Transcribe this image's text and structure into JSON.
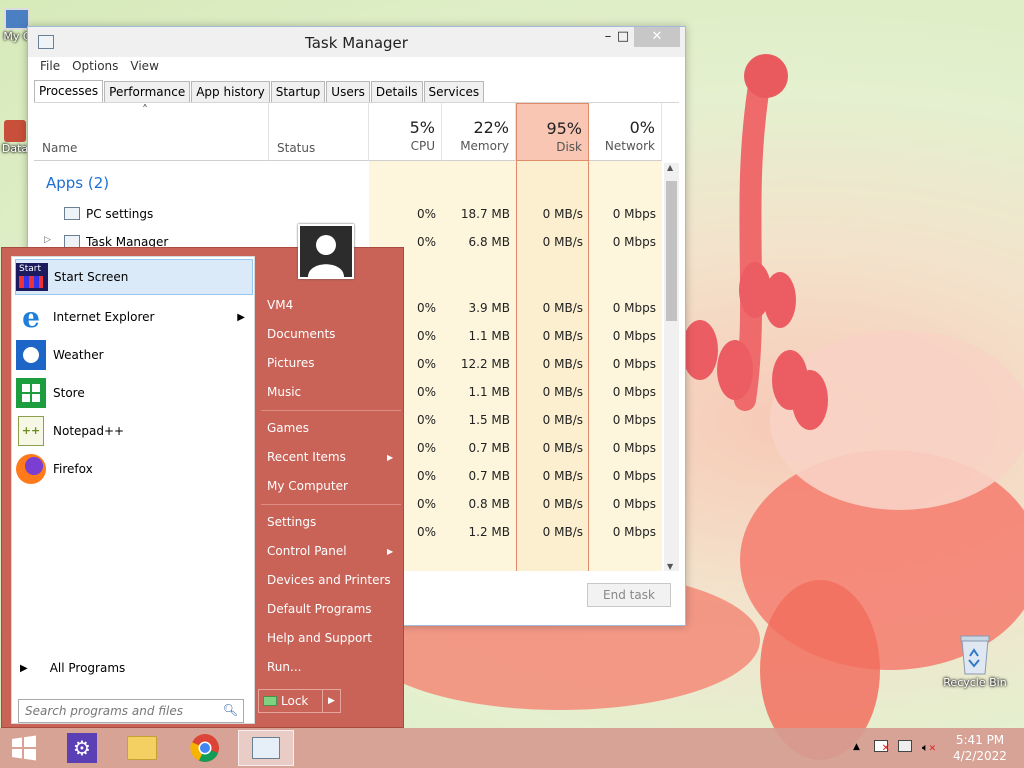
{
  "desktop": {
    "icons": [
      {
        "label": "My C",
        "icon": "computer-icon"
      },
      {
        "label": "Data",
        "icon": "database-icon"
      },
      {
        "label": "Recycle Bin",
        "icon": "recycle-bin-icon"
      }
    ]
  },
  "task_manager": {
    "title": "Task Manager",
    "window_buttons": {
      "minimize": "–",
      "maximize": "□",
      "close": "✕"
    },
    "menu": [
      "File",
      "Options",
      "View"
    ],
    "tabs": [
      "Processes",
      "Performance",
      "App history",
      "Startup",
      "Users",
      "Details",
      "Services"
    ],
    "active_tab": "Processes",
    "sort_indicator": "˄",
    "columns": {
      "name": "Name",
      "status": "Status",
      "cpu": {
        "pct": "5%",
        "label": "CPU"
      },
      "memory": {
        "pct": "22%",
        "label": "Memory"
      },
      "disk": {
        "pct": "95%",
        "label": "Disk"
      },
      "network": {
        "pct": "0%",
        "label": "Network"
      }
    },
    "group_apps": "Apps (2)",
    "apps": [
      {
        "name": "PC settings",
        "cpu": "0%",
        "memory": "18.7 MB",
        "disk": "0 MB/s",
        "network": "0 Mbps"
      },
      {
        "name": "Task Manager",
        "cpu": "0%",
        "memory": "6.8 MB",
        "disk": "0 MB/s",
        "network": "0 Mbps"
      }
    ],
    "background_rows": [
      {
        "cpu": "0%",
        "memory": "3.9 MB",
        "disk": "0 MB/s",
        "network": "0 Mbps"
      },
      {
        "cpu": "0%",
        "memory": "1.1 MB",
        "disk": "0 MB/s",
        "network": "0 Mbps"
      },
      {
        "cpu": "0%",
        "memory": "12.2 MB",
        "disk": "0 MB/s",
        "network": "0 Mbps"
      },
      {
        "cpu": "0%",
        "memory": "1.1 MB",
        "disk": "0 MB/s",
        "network": "0 Mbps"
      },
      {
        "cpu": "0%",
        "memory": "1.5 MB",
        "disk": "0 MB/s",
        "network": "0 Mbps"
      },
      {
        "cpu": "0%",
        "memory": "0.7 MB",
        "disk": "0 MB/s",
        "network": "0 Mbps"
      },
      {
        "cpu": "0%",
        "memory": "0.7 MB",
        "disk": "0 MB/s",
        "network": "0 Mbps"
      },
      {
        "cpu": "0%",
        "memory": "0.8 MB",
        "disk": "0 MB/s",
        "network": "0 Mbps"
      },
      {
        "cpu": "0%",
        "memory": "1.2 MB",
        "disk": "0 MB/s",
        "network": "0 Mbps"
      }
    ],
    "end_task": "End task"
  },
  "start_menu": {
    "pinned": [
      {
        "label": "Start Screen",
        "icon": "start-screen-icon",
        "has_submenu": false
      },
      {
        "label": "Internet Explorer",
        "icon": "internet-explorer-icon",
        "has_submenu": true
      },
      {
        "label": "Weather",
        "icon": "weather-icon",
        "has_submenu": false
      },
      {
        "label": "Store",
        "icon": "store-icon",
        "has_submenu": false
      },
      {
        "label": "Notepad++",
        "icon": "notepadpp-icon",
        "has_submenu": false
      },
      {
        "label": "Firefox",
        "icon": "firefox-icon",
        "has_submenu": false
      }
    ],
    "start_tile_text": "Start",
    "all_programs": "All Programs",
    "search_placeholder": "Search programs and files",
    "right_items": [
      {
        "label": "VM4",
        "submenu": false
      },
      {
        "label": "Documents",
        "submenu": false
      },
      {
        "label": "Pictures",
        "submenu": false
      },
      {
        "label": "Music",
        "submenu": false
      },
      {
        "label": "Games",
        "submenu": false
      },
      {
        "label": "Recent Items",
        "submenu": true
      },
      {
        "label": "My Computer",
        "submenu": false
      },
      {
        "label": "Settings",
        "submenu": false
      },
      {
        "label": "Control Panel",
        "submenu": true
      },
      {
        "label": "Devices and Printers",
        "submenu": false
      },
      {
        "label": "Default Programs",
        "submenu": false
      },
      {
        "label": "Help and Support",
        "submenu": false
      },
      {
        "label": "Run...",
        "submenu": false
      }
    ],
    "lock_label": "Lock",
    "lock_arrow": "▶"
  },
  "taskbar": {
    "items": [
      "start-button",
      "settings-icon",
      "file-explorer-icon",
      "chrome-icon",
      "task-manager-icon"
    ],
    "tray": {
      "overflow": "▲"
    },
    "time": "5:41 PM",
    "date": "4/2/2022"
  },
  "colors": {
    "start_menu_bg": "#c96257",
    "disk_highlight": "#f8c6b2",
    "heat_fill": "#fdf6dc",
    "accent_blue": "#1e6fd2"
  }
}
